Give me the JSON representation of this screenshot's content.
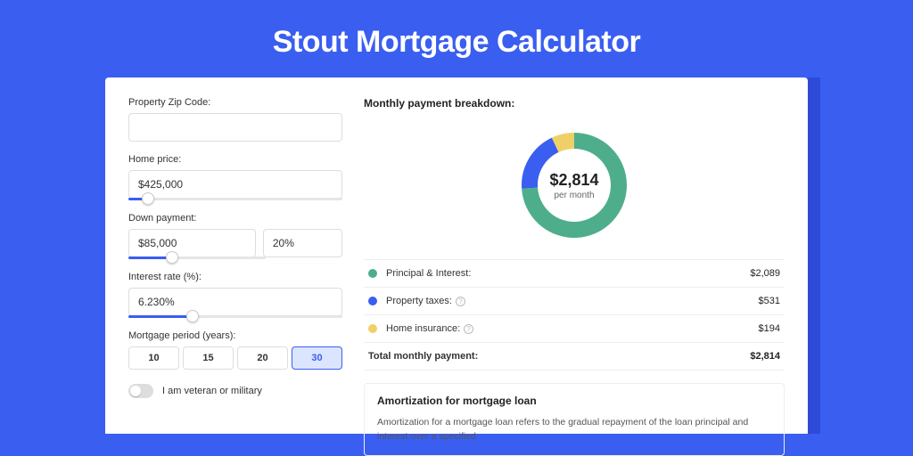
{
  "title": "Stout Mortgage Calculator",
  "form": {
    "zip_label": "Property Zip Code:",
    "zip_value": "",
    "home_price_label": "Home price:",
    "home_price_value": "$425,000",
    "home_price_pct": 9,
    "down_payment_label": "Down payment:",
    "down_payment_value": "$85,000",
    "down_payment_pct_value": "20%",
    "down_payment_slider_pct": 20,
    "interest_label": "Interest rate (%):",
    "interest_value": "6.230%",
    "interest_slider_pct": 30,
    "period_label": "Mortgage period (years):",
    "periods": [
      "10",
      "15",
      "20",
      "30"
    ],
    "period_selected_index": 3,
    "veteran_label": "I am veteran or military"
  },
  "breakdown": {
    "title": "Monthly payment breakdown:",
    "center_amount": "$2,814",
    "center_sub": "per month",
    "items": [
      {
        "label": "Principal & Interest:",
        "value": "$2,089",
        "color": "#4eae8b",
        "info": false,
        "pct": 74
      },
      {
        "label": "Property taxes:",
        "value": "$531",
        "color": "#3a5ef0",
        "info": true,
        "pct": 19
      },
      {
        "label": "Home insurance:",
        "value": "$194",
        "color": "#efd068",
        "info": true,
        "pct": 7
      }
    ],
    "total_label": "Total monthly payment:",
    "total_value": "$2,814"
  },
  "amortization": {
    "title": "Amortization for mortgage loan",
    "text": "Amortization for a mortgage loan refers to the gradual repayment of the loan principal and interest over a specified"
  },
  "chart_data": {
    "type": "pie",
    "title": "Monthly payment breakdown",
    "categories": [
      "Principal & Interest",
      "Property taxes",
      "Home insurance"
    ],
    "values": [
      2089,
      531,
      194
    ],
    "total": 2814,
    "unit": "USD/month"
  }
}
